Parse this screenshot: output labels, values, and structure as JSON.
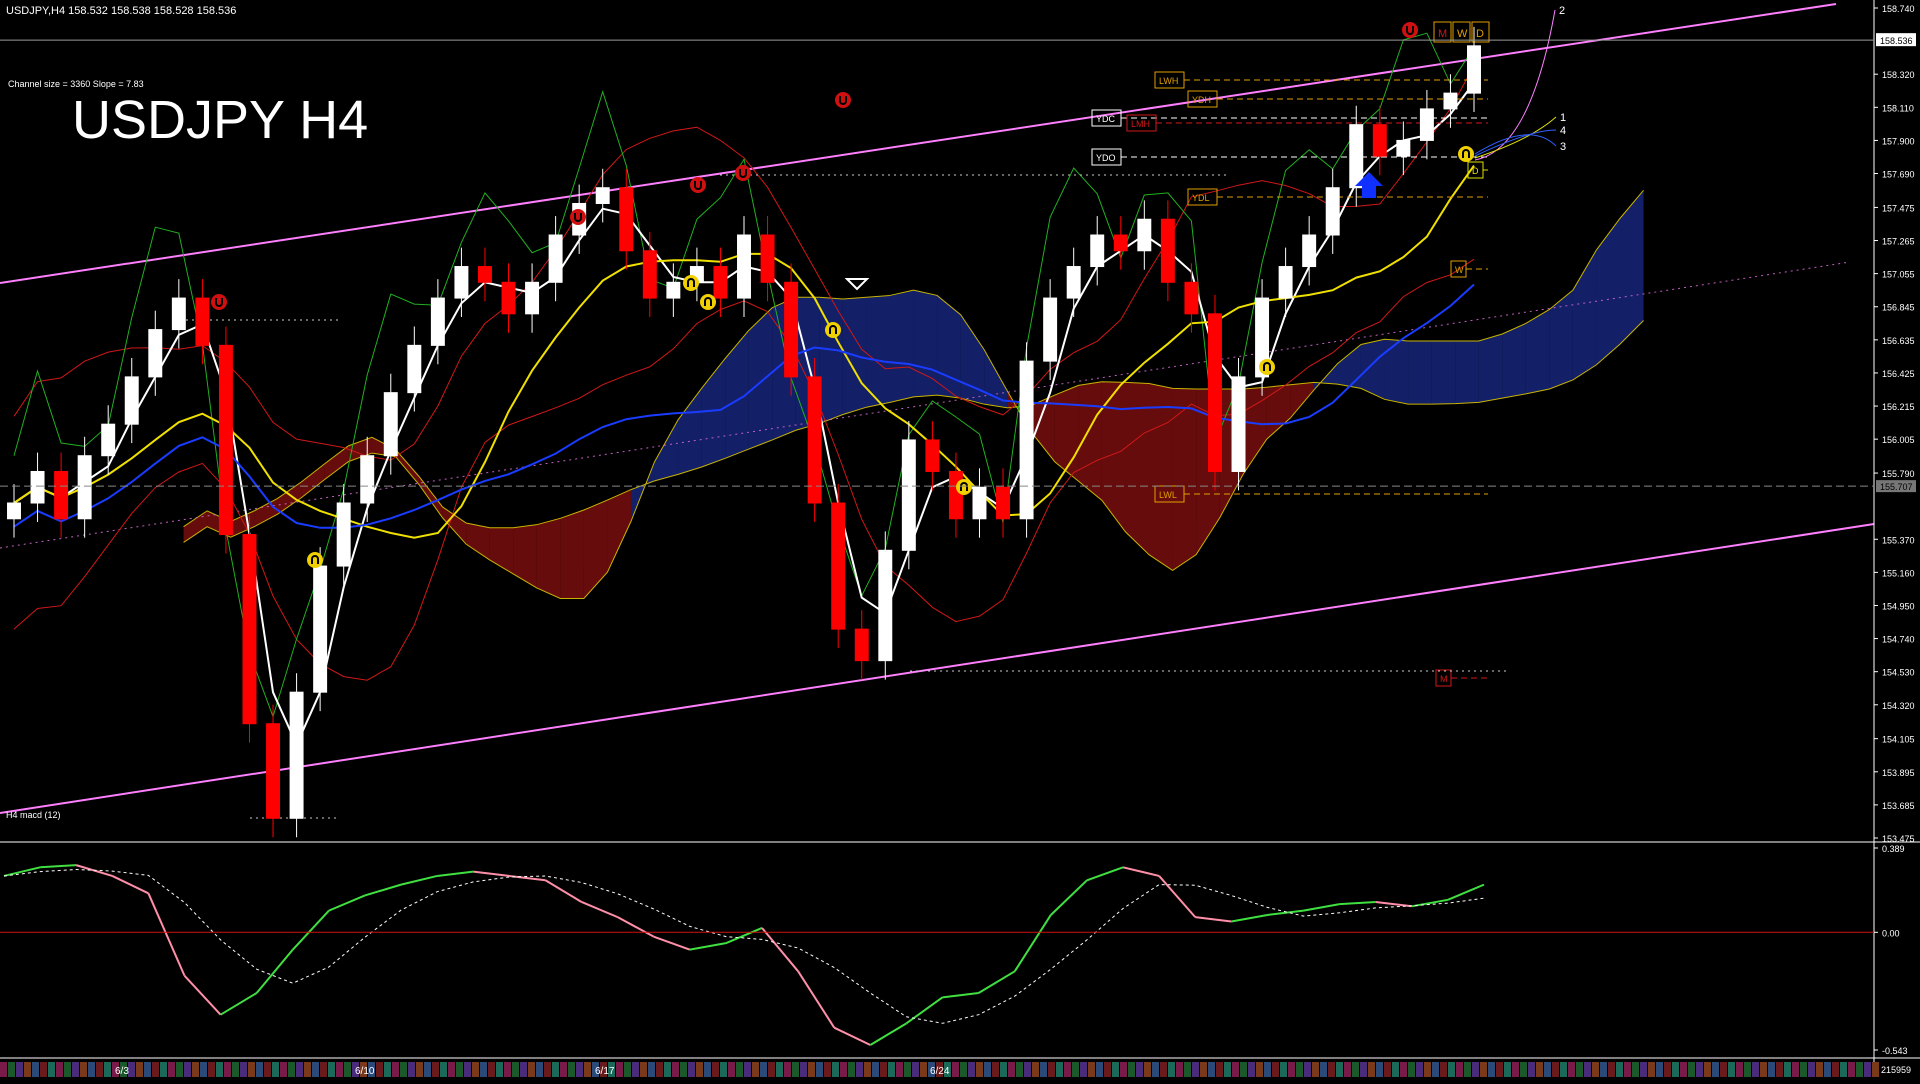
{
  "header": {
    "info_line": "USDJPY,H4  158.532 158.538 158.528 158.536",
    "channel_info": "Channel size = 3360 Slope = 7.83",
    "title": "USDJPY H4"
  },
  "price_axis": {
    "ticks": [
      "158.740",
      "158.536",
      "158.320",
      "158.110",
      "157.900",
      "157.690",
      "157.475",
      "157.265",
      "157.055",
      "156.845",
      "156.635",
      "156.425",
      "156.215",
      "156.005",
      "155.790",
      "155.707",
      "155.370",
      "155.160",
      "154.950",
      "154.740",
      "154.530",
      "154.320",
      "154.105",
      "153.895",
      "153.685",
      "153.475"
    ],
    "current_price": "158.536",
    "mid_marker": "155.707"
  },
  "macd_panel": {
    "label": "H4  macd (12)",
    "ticks": [
      "0.389",
      "0.00",
      "-0.543"
    ]
  },
  "time_axis": {
    "dates": [
      "6/3",
      "6/10",
      "6/17",
      "6/24"
    ],
    "corner_value": "215959"
  },
  "levels": {
    "labels": [
      "LWH",
      "YDC",
      "LMH",
      "YDH",
      "YDO",
      "YDL",
      "LWL",
      "W",
      "D",
      "M"
    ],
    "top_right_markers": [
      "M",
      "W",
      "D"
    ],
    "fan_numbers": [
      "2",
      "1",
      "4",
      "3"
    ]
  },
  "colors": {
    "background": "#000000",
    "channel": "#ff7fff",
    "bull_candle": "#ffffff",
    "bear_candle": "#ff0000",
    "ma_white": "#ffffff",
    "ma_yellow": "#f0e000",
    "ma_blue": "#1a3cff",
    "macd_green": "#40e040",
    "macd_pink": "#ff8fa8",
    "cloud_blue": "#1a2a8a",
    "cloud_red": "#8a1010"
  },
  "chart_data": {
    "type": "candlestick",
    "symbol": "USDJPY",
    "timeframe": "H4",
    "ylim": [
      153.475,
      158.74
    ],
    "x_dates": [
      "6/3",
      "6/10",
      "6/17",
      "6/24"
    ],
    "last": {
      "open": 158.532,
      "high": 158.538,
      "low": 158.528,
      "close": 158.536
    },
    "close_series": [
      155.6,
      155.8,
      155.5,
      155.9,
      156.1,
      156.4,
      156.7,
      156.9,
      156.6,
      155.4,
      154.2,
      153.6,
      154.4,
      155.2,
      155.6,
      155.9,
      156.3,
      156.6,
      156.9,
      157.1,
      157.0,
      156.8,
      157.0,
      157.3,
      157.5,
      157.6,
      157.2,
      156.9,
      157.0,
      157.1,
      156.9,
      157.3,
      157.0,
      156.4,
      155.6,
      154.8,
      154.6,
      155.3,
      156.0,
      155.8,
      155.5,
      155.7,
      155.5,
      156.5,
      156.9,
      157.1,
      157.3,
      157.2,
      157.4,
      157.0,
      156.8,
      155.8,
      156.4,
      156.9,
      157.1,
      157.3,
      157.6,
      158.0,
      157.8,
      157.9,
      158.1,
      158.2,
      158.5
    ],
    "macd": {
      "ylim": [
        -0.543,
        0.389
      ],
      "series": [
        0.26,
        0.3,
        0.31,
        0.26,
        0.18,
        -0.2,
        -0.38,
        -0.28,
        -0.08,
        0.1,
        0.17,
        0.22,
        0.26,
        0.28,
        0.26,
        0.24,
        0.14,
        0.07,
        -0.02,
        -0.08,
        -0.05,
        0.02,
        -0.18,
        -0.44,
        -0.52,
        -0.42,
        -0.3,
        -0.28,
        -0.18,
        0.08,
        0.24,
        0.3,
        0.26,
        0.07,
        0.05,
        0.08,
        0.1,
        0.13,
        0.14,
        0.12,
        0.15,
        0.22
      ]
    }
  }
}
